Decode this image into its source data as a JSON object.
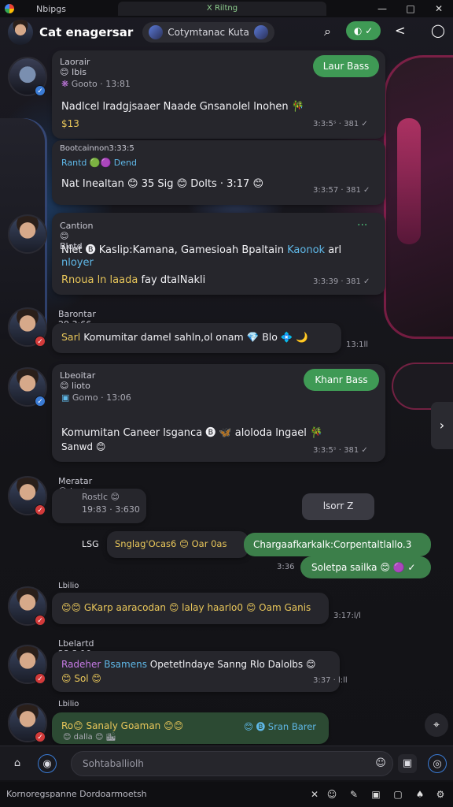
{
  "system": {
    "app_label": "Nbipgs",
    "tab_label": "X  Riltng",
    "window_controls": [
      "—",
      "□",
      "✕"
    ]
  },
  "header": {
    "title": "Cat enagersar",
    "pill_label": "Cotymtanac  Kuta",
    "green_label": "◐ ✓",
    "search_icon": "⌕",
    "share_icon": "<",
    "chat_icon": "◯"
  },
  "messages": [
    {
      "sender": "Laorair 😊 Ibis",
      "sub": "Gooto · 13:81",
      "text": "Nadlcel lradgjsaaer Naade Gnsanolel lnohen 🎋",
      "extra": "$13",
      "time": "3:3:5ˢ · 381 ✓",
      "button": "Laur Bass"
    },
    {
      "sender": "Bootcainnon3:33:5",
      "sub": "Rantd 🟢🟣 Dend",
      "text": "Nat Inealtan 😊 35 Sig 😊 Dolts · 3:17 😊",
      "time": "3:3:57 · 381 ✓"
    },
    {
      "sender": "Cantion 😊 Blotd",
      "text_a": "Nlet 🅑 Kaslip:Kamana, Gamesioah Bpaltain",
      "text_a_cyan": "Kaonok",
      "text_a_end": "arl",
      "text_b": "nloyer",
      "text_c_gold": "Rnoua ln laada",
      "text_c": "fay dtalNakli",
      "time": "3:3:39 · 381 ✓",
      "more": "···"
    },
    {
      "sender": "Barontar 29 3:66",
      "text_gold": "Sarl",
      "text": "Komumitar damel sahln,ol onam 💎 Blo 💠 🌙",
      "time": "13:1ll"
    },
    {
      "sender": "Lbeoitar 😊 lioto",
      "sub": "Gomo · 13:06",
      "text": "Komumitan Caneer lsganca 🅑 🦋 aloloda lngael 🎋",
      "extra": "Sanwd 😊",
      "time": "3:3:5ˢ · 381 ✓",
      "button": "Khanr Bass"
    },
    {
      "sender": "Meratar 😊 lovto",
      "sub_a": "Rostlc 😊",
      "sub_b": "19:83 · 3:630",
      "button": "lsorr Z",
      "row_left": "LSG",
      "row_mid": "Snglag'Ocas6 😊 Oar 0as",
      "out_top": "Chargaafkarkalk:Corpentaltlallo.3",
      "out_bottom": "Soletpa sailka 😊 🟣 ✓",
      "out_time": "3:36"
    },
    {
      "sender": "Lbilio",
      "text": "😊😊 GKarp aaracodan 😊 lalay haarlo0 😊 Oam Ganis",
      "time": "3:17:l/l"
    },
    {
      "sender": "Lbelartd 23 3:10",
      "text_purple": "Radeher",
      "text_cyan": "Bsamens",
      "text": "Opetetlndaye Sanng Rlo Dalolbs 😊",
      "extra": "😊 Sol 😊",
      "time": "3:37 ·  l:ll"
    },
    {
      "sender": "Lbilio",
      "text": "Ro😊 Sanaly Goaman 😊😊",
      "text_end": "😊 🅑 Sran Barer",
      "extra": "😊 dalla 😊 🏙"
    }
  ],
  "composer": {
    "placeholder": "Sohtaballiolh",
    "left_icon_a": "⌂",
    "left_icon_b": "◉",
    "right_icon_a": "☺",
    "right_icon_b": "▣",
    "right_icon_c": "◎"
  },
  "statusbar": {
    "text": "Kornoregspanne Dordoarmoetsh",
    "icons": [
      "✕",
      "☺",
      "✎",
      "▣",
      "▢",
      "♠",
      "⚙"
    ]
  },
  "right_arrow": "›",
  "fab_icon": "⌖"
}
